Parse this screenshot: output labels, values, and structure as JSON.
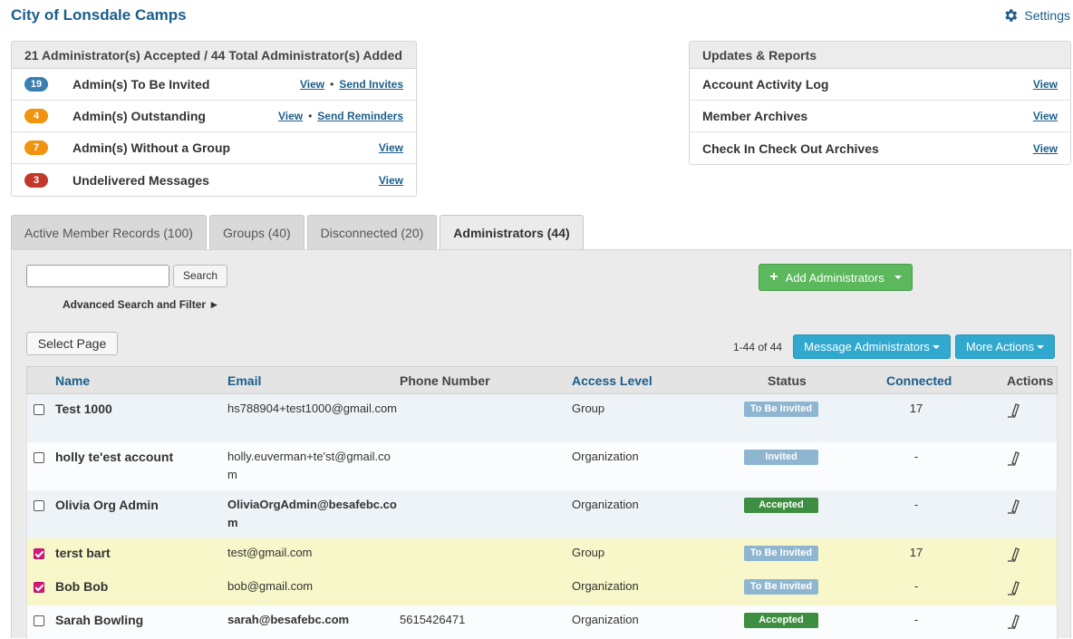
{
  "app": {
    "title": "City of Lonsdale Camps",
    "settings_label": "Settings"
  },
  "admin_panel": {
    "header": "21 Administrator(s) Accepted / 44 Total Administrator(s) Added",
    "rows": [
      {
        "count": "19",
        "label": "Admin(s) To Be Invited",
        "link1": "View",
        "link2": "Send Invites",
        "color": "#3b7fb0"
      },
      {
        "count": "4",
        "label": "Admin(s) Outstanding",
        "link1": "View",
        "link2": "Send Reminders",
        "color": "#f0930f"
      },
      {
        "count": "7",
        "label": "Admin(s) Without a Group",
        "link1": "View",
        "link2": "",
        "color": "#f0930f"
      },
      {
        "count": "3",
        "label": "Undelivered Messages",
        "link1": "View",
        "link2": "",
        "color": "#c0392b"
      }
    ]
  },
  "reports_panel": {
    "header": "Updates & Reports",
    "rows": [
      {
        "label": "Account Activity Log",
        "link": "View"
      },
      {
        "label": "Member Archives",
        "link": "View"
      },
      {
        "label": "Check In Check Out Archives",
        "link": "View"
      }
    ]
  },
  "tabs": [
    {
      "label": "Active Member Records (100)"
    },
    {
      "label": "Groups (40)"
    },
    {
      "label": "Disconnected (20)"
    },
    {
      "label": "Administrators (44)"
    }
  ],
  "search": {
    "button": "Search",
    "advanced": "Advanced Search and Filter ►",
    "value": ""
  },
  "buttons": {
    "add_admins": "Add Administrators",
    "select_page": "Select Page",
    "message_admins": "Message Administrators",
    "more_actions": "More Actions"
  },
  "pagination": {
    "range": "1-44 of 44"
  },
  "table": {
    "columns": [
      "Name",
      "Email",
      "Phone Number",
      "Access Level",
      "Status",
      "Connected",
      "Actions"
    ],
    "rows": [
      {
        "name": "Test 1000",
        "email": "hs788904+test1000@gmail.com",
        "phone": "",
        "access": "Group",
        "status": "To Be Invited",
        "connected": "17",
        "checked": false
      },
      {
        "name": "holly te'est account",
        "email": "holly.euverman+te'st@gmail.com",
        "phone": "",
        "access": "Organization",
        "status": "Invited",
        "connected": "-",
        "checked": false
      },
      {
        "name": "Olivia Org Admin",
        "email": "OliviaOrgAdmin@besafebc.com",
        "phone": "",
        "access": "Organization",
        "status": "Accepted",
        "connected": "-",
        "checked": false
      },
      {
        "name": "terst bart",
        "email": "test@gmail.com",
        "phone": "",
        "access": "Group",
        "status": "To Be Invited",
        "connected": "17",
        "checked": true
      },
      {
        "name": "Bob Bob",
        "email": "bob@gmail.com",
        "phone": "",
        "access": "Organization",
        "status": "To Be Invited",
        "connected": "-",
        "checked": true
      },
      {
        "name": "Sarah Bowling",
        "email": "sarah@besafebc.com",
        "phone": "5615426471",
        "access": "Organization",
        "status": "Accepted",
        "connected": "-",
        "checked": false
      }
    ]
  }
}
